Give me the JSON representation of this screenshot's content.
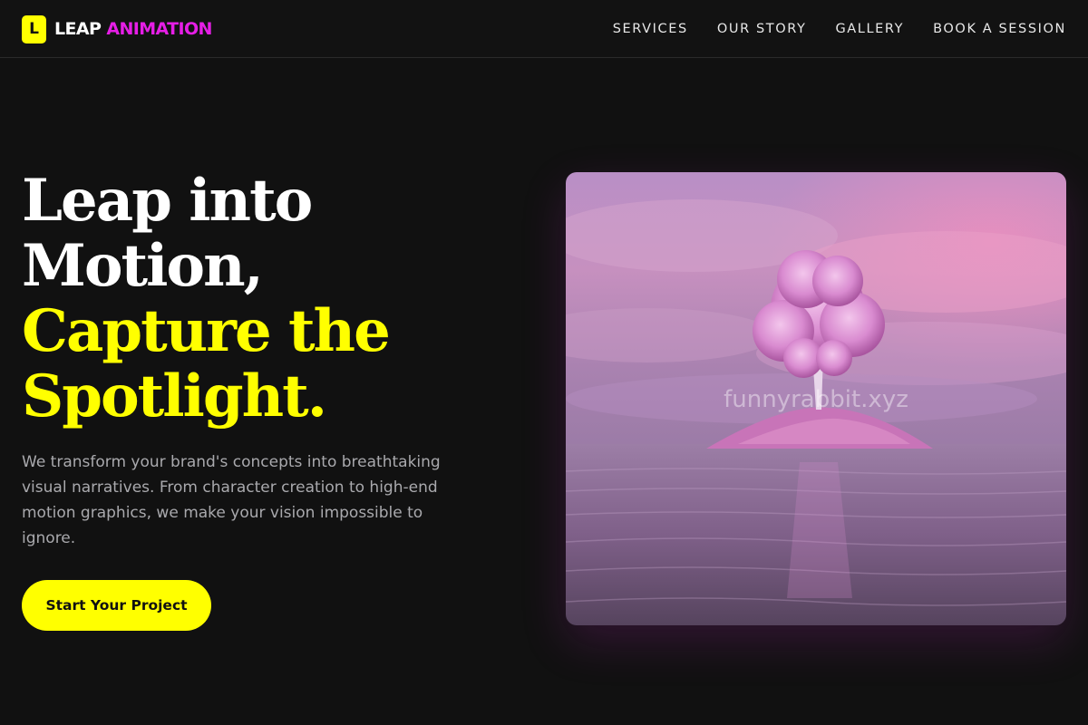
{
  "brand": {
    "mark": "L",
    "name_part1": "LEAP",
    "name_part2": "ANIMATION"
  },
  "nav": {
    "items": [
      {
        "label": "SERVICES"
      },
      {
        "label": "OUR STORY"
      },
      {
        "label": "GALLERY"
      },
      {
        "label": "BOOK A SESSION"
      }
    ]
  },
  "hero": {
    "headline_line1": "Leap into",
    "headline_line2": "Motion,",
    "headline_line3": "Capture the",
    "headline_line4": "Spotlight.",
    "description": "We transform your brand's concepts into breathtaking visual narratives. From character creation to high-end motion graphics, we make your vision impossible to ignore.",
    "cta_label": "Start Your Project",
    "image_watermark": "funnyrabbit.xyz"
  },
  "colors": {
    "background": "#111111",
    "accent_yellow": "#ffff00",
    "accent_magenta": "#e61ee6",
    "body_text": "#a9a9ad"
  }
}
